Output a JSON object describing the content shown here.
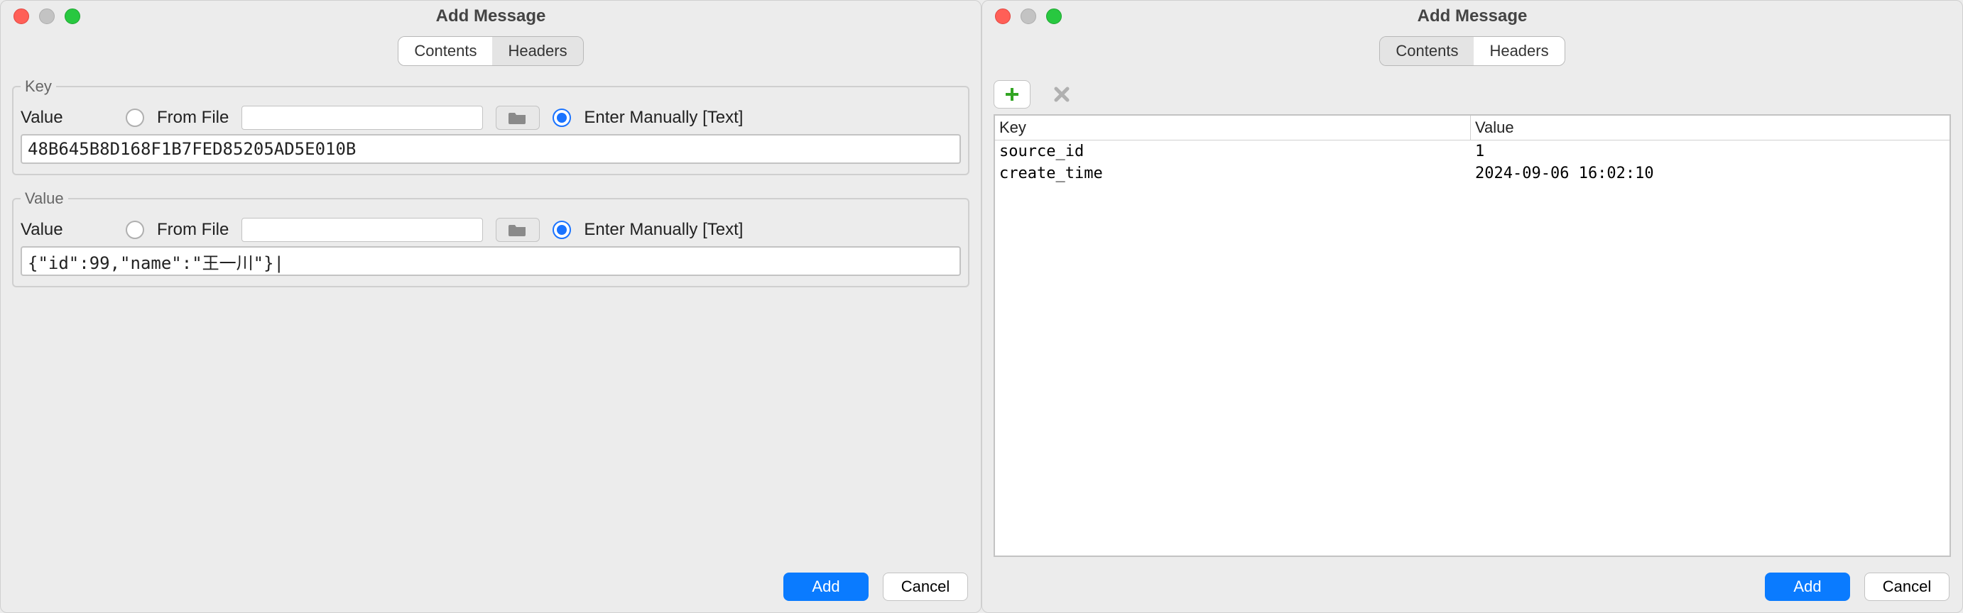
{
  "left": {
    "title": "Add Message",
    "tabs": {
      "contents": "Contents",
      "headers": "Headers",
      "active": "contents"
    },
    "group1": {
      "legend": "Key",
      "value_label": "Value",
      "from_file_label": "From File",
      "enter_manually_label": "Enter Manually [Text]",
      "selected": "manual",
      "text": "48B645B8D168F1B7FED85205AD5E010B"
    },
    "group2": {
      "legend": "Value",
      "value_label": "Value",
      "from_file_label": "From File",
      "enter_manually_label": "Enter Manually [Text]",
      "selected": "manual",
      "text": "{\"id\":99,\"name\":\"王一川\"}|"
    },
    "buttons": {
      "add": "Add",
      "cancel": "Cancel"
    }
  },
  "right": {
    "title": "Add Message",
    "tabs": {
      "contents": "Contents",
      "headers": "Headers",
      "active": "headers"
    },
    "table": {
      "head": {
        "key": "Key",
        "value": "Value"
      },
      "rows": [
        {
          "key": "source_id",
          "value": "1"
        },
        {
          "key": "create_time",
          "value": "2024-09-06 16:02:10"
        }
      ]
    },
    "buttons": {
      "add": "Add",
      "cancel": "Cancel"
    }
  }
}
